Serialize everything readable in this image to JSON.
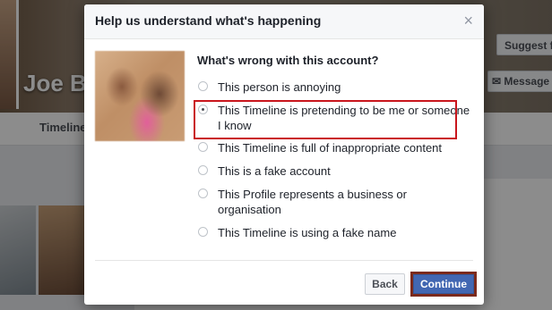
{
  "background": {
    "profile_name": "Joe B",
    "suggest_button": "Suggest f",
    "message_button": "Message",
    "timeline_tab": "Timeline"
  },
  "dialog": {
    "title": "Help us understand what's happening",
    "close_icon": "×",
    "question": "What's wrong with this account?",
    "options": [
      {
        "label": "This person is annoying",
        "checked": false
      },
      {
        "label": "This Timeline is pretending to be me or someone I know",
        "checked": true
      },
      {
        "label": "This Timeline is full of inappropriate content",
        "checked": false
      },
      {
        "label": "This is a fake account",
        "checked": false
      },
      {
        "label": "This Profile represents a business or organisation",
        "checked": false
      },
      {
        "label": "This Timeline is using a fake name",
        "checked": false
      }
    ],
    "back_label": "Back",
    "continue_label": "Continue"
  },
  "colors": {
    "highlight_box": "#c9161d",
    "continue_bg": "#4267b2",
    "continue_outline": "#7b2a1d"
  },
  "icons": {
    "close": "close-icon",
    "message": "speech-bubble-icon"
  }
}
